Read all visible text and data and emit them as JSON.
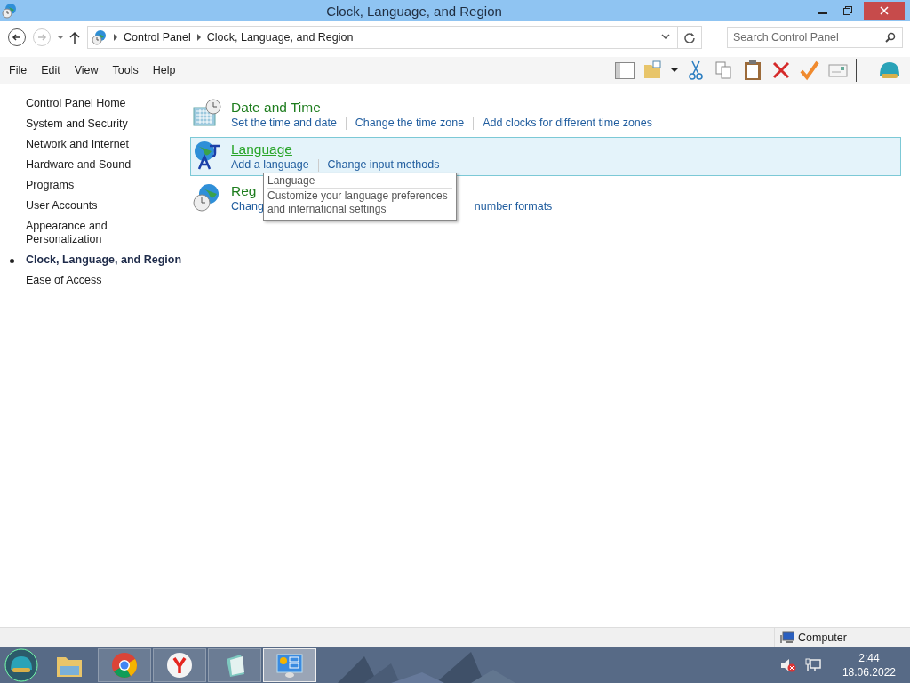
{
  "window": {
    "title": "Clock, Language, and Region"
  },
  "address_bar": {
    "path": [
      "Control Panel",
      "Clock, Language, and Region"
    ]
  },
  "search": {
    "placeholder": "Search Control Panel"
  },
  "menu": [
    "File",
    "Edit",
    "View",
    "Tools",
    "Help"
  ],
  "sidebar": {
    "home": "Control Panel Home",
    "items": [
      {
        "label": "System and Security",
        "selected": false
      },
      {
        "label": "Network and Internet",
        "selected": false
      },
      {
        "label": "Hardware and Sound",
        "selected": false
      },
      {
        "label": "Programs",
        "selected": false
      },
      {
        "label": "User Accounts",
        "selected": false
      },
      {
        "label": "Appearance and Personalization",
        "selected": false
      },
      {
        "label": "Clock, Language, and Region",
        "selected": true
      },
      {
        "label": "Ease of Access",
        "selected": false
      }
    ]
  },
  "categories": [
    {
      "kind": "clock",
      "title": "Date and Time",
      "selected": false,
      "links": [
        "Set the time and date",
        "Change the time zone",
        "Add clocks for different time zones"
      ]
    },
    {
      "kind": "language",
      "title": "Language",
      "selected": true,
      "links": [
        "Add a language",
        "Change input methods"
      ]
    },
    {
      "kind": "region",
      "title": "Reg",
      "selected": false,
      "links": [
        "Chang",
        "number formats"
      ]
    }
  ],
  "tooltip": {
    "title": "Language",
    "lines": [
      "Customize your language preferences",
      "and international settings"
    ]
  },
  "status_bar": {
    "location": "Computer"
  },
  "taskbar": {
    "apps": [
      {
        "kind": "explorer",
        "selected": false
      },
      {
        "kind": "chrome",
        "selected": false
      },
      {
        "kind": "yandex",
        "selected": false
      },
      {
        "kind": "notepad",
        "selected": false
      },
      {
        "kind": "control-panel",
        "selected": true
      }
    ],
    "time": "2:44",
    "date": "18.06.2022"
  }
}
